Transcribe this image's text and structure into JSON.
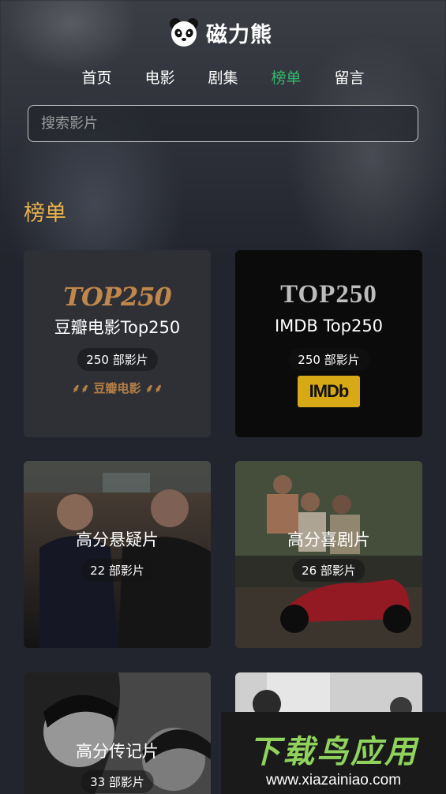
{
  "app": {
    "title": "磁力熊"
  },
  "nav": [
    {
      "label": "首页",
      "active": false
    },
    {
      "label": "电影",
      "active": false
    },
    {
      "label": "剧集",
      "active": false
    },
    {
      "label": "榜单",
      "active": true
    },
    {
      "label": "留言",
      "active": false
    }
  ],
  "search": {
    "placeholder": "搜索影片"
  },
  "section": {
    "title": "榜单"
  },
  "cards": [
    {
      "title": "豆瓣电影Top250",
      "count": "250 部影片",
      "logo_text": "TOP250",
      "badge_text": "豆瓣电影"
    },
    {
      "title": "IMDB Top250",
      "count": "250 部影片",
      "logo_text": "TOP250",
      "badge_text": "IMDb"
    },
    {
      "title": "高分悬疑片",
      "count": "22 部影片"
    },
    {
      "title": "高分喜剧片",
      "count": "26 部影片"
    },
    {
      "title": "高分传记片",
      "count": "33 部影片"
    },
    {
      "title": "",
      "count": ""
    }
  ],
  "watermark": {
    "title": "下载鸟应用",
    "url": "www.xiazainiao.com"
  },
  "colors": {
    "accent_green": "#33b86c",
    "section_gold": "#e7b04a",
    "imdb_yellow": "#d8a916"
  }
}
